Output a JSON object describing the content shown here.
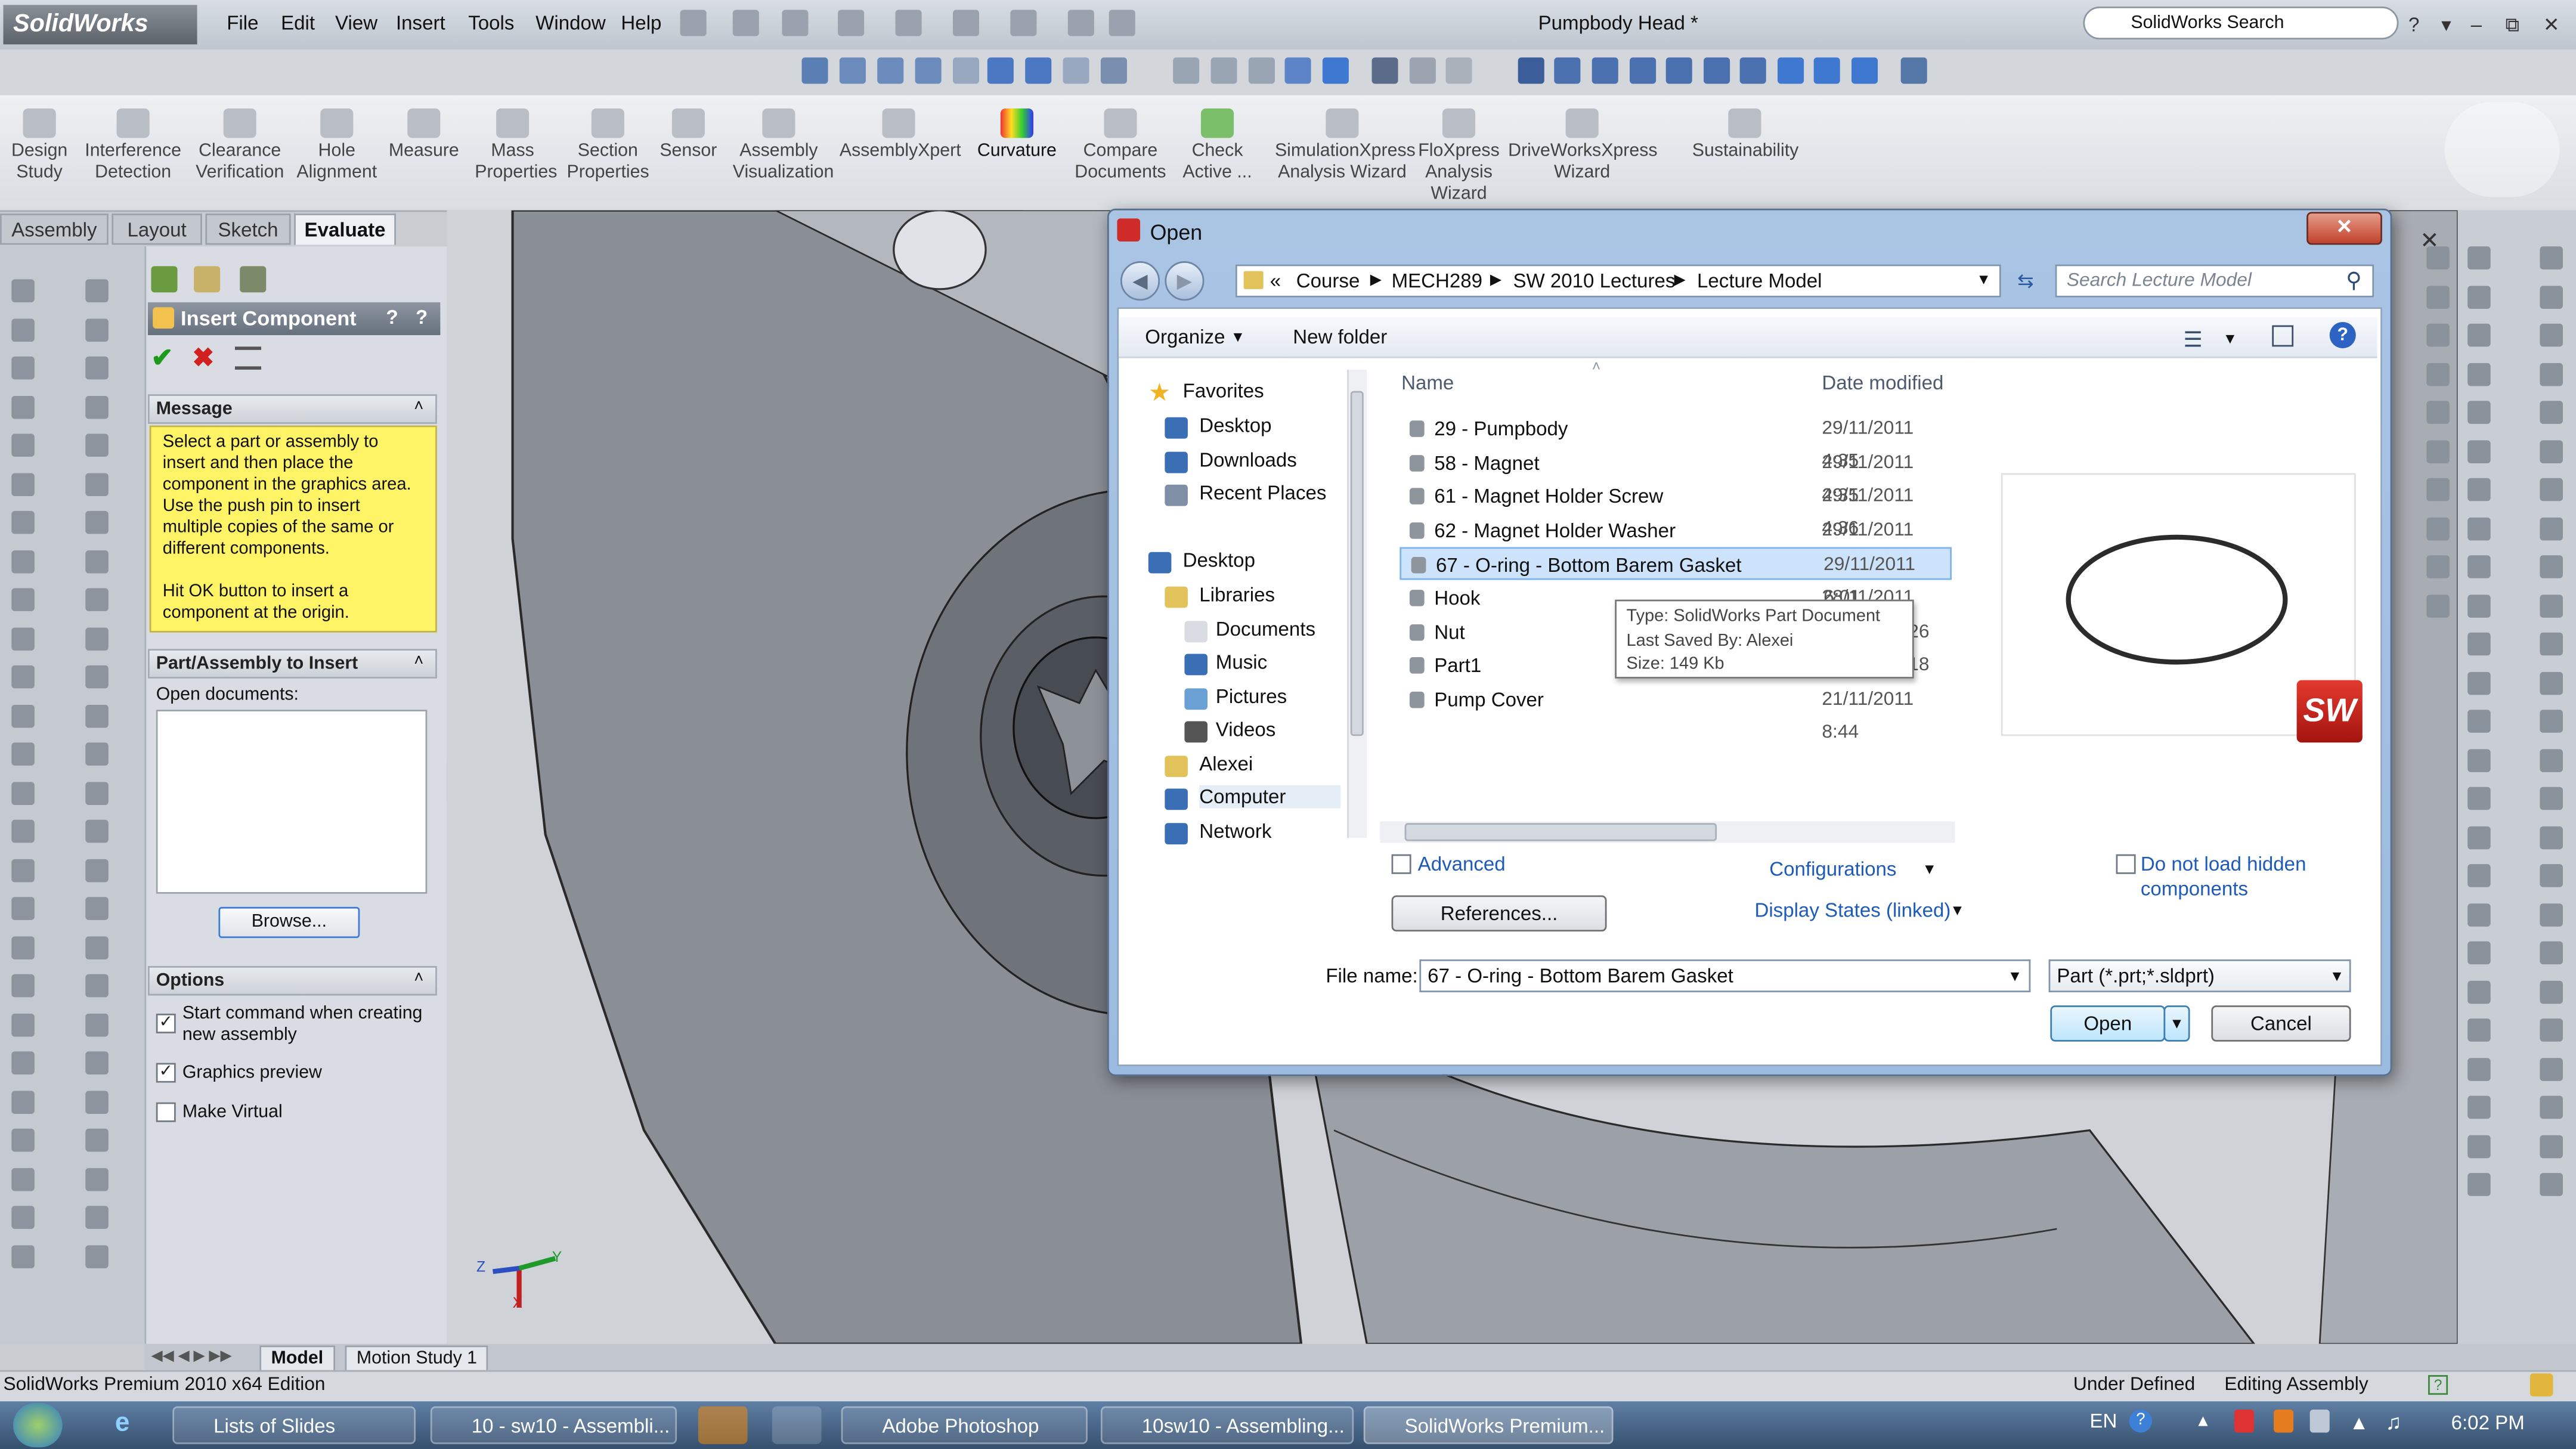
{
  "app": {
    "logo": "SolidWorks",
    "menu": [
      "File",
      "Edit",
      "View",
      "Insert",
      "Tools",
      "Window",
      "Help"
    ],
    "document_title": "Pumpbody Head *",
    "search_placeholder": "SolidWorks Search"
  },
  "command_manager": {
    "buttons": [
      {
        "label": "Design\nStudy",
        "icon": "design-study-icon"
      },
      {
        "label": "Interference\nDetection",
        "icon": "interference-detection-icon"
      },
      {
        "label": "Clearance\nVerification",
        "icon": "clearance-verification-icon"
      },
      {
        "label": "Hole\nAlignment",
        "icon": "hole-alignment-icon"
      },
      {
        "label": "Measure",
        "icon": "measure-icon"
      },
      {
        "label": "Mass\nProperties",
        "icon": "mass-properties-icon"
      },
      {
        "label": "Section\nProperties",
        "icon": "section-properties-icon"
      },
      {
        "label": "Sensor",
        "icon": "sensor-icon"
      },
      {
        "label": "Assembly\nVisualization",
        "icon": "assembly-visualization-icon"
      },
      {
        "label": "AssemblyXpert",
        "icon": "assemblyxpert-icon"
      },
      {
        "label": "Curvature",
        "icon": "curvature-icon"
      },
      {
        "label": "Compare\nDocuments",
        "icon": "compare-documents-icon"
      },
      {
        "label": "Check\nActive ...",
        "icon": "check-active-icon"
      },
      {
        "label": "SimulationXpress\nAnalysis Wizard",
        "icon": "simulationxpress-icon"
      },
      {
        "label": "FloXpress\nAnalysis\nWizard",
        "icon": "floxpress-icon"
      },
      {
        "label": "DriveWorksXpress\nWizard",
        "icon": "driveworksxpress-icon"
      },
      {
        "label": "Sustainability",
        "icon": "sustainability-icon"
      }
    ],
    "tabs": [
      "Assembly",
      "Layout",
      "Sketch",
      "Evaluate"
    ],
    "active_tab": "Evaluate"
  },
  "property_manager": {
    "title": "Insert Component",
    "message_header": "Message",
    "message": "Select a part or assembly to insert and then place the component in the graphics area. Use the push pin to insert multiple copies of the same or different components.\n\nHit OK button to insert a component at the origin.",
    "part_header": "Part/Assembly to Insert",
    "open_documents_label": "Open documents:",
    "browse_label": "Browse...",
    "options_header": "Options",
    "options": [
      {
        "label": "Start command when creating new assembly",
        "checked": true
      },
      {
        "label": "Graphics preview",
        "checked": true
      },
      {
        "label": "Make Virtual",
        "checked": false
      }
    ]
  },
  "dialog": {
    "title": "Open",
    "breadcrumb": [
      "«",
      "Course",
      "MECH289",
      "SW 2010 Lectures",
      "Lecture Model"
    ],
    "search_placeholder": "Search Lecture Model",
    "organize_label": "Organize",
    "new_folder_label": "New folder",
    "nav": [
      {
        "label": "Favorites",
        "indent": 0,
        "icon": "star-icon"
      },
      {
        "label": "Desktop",
        "indent": 1,
        "icon": "desktop-icon"
      },
      {
        "label": "Downloads",
        "indent": 1,
        "icon": "downloads-icon"
      },
      {
        "label": "Recent Places",
        "indent": 1,
        "icon": "recent-places-icon"
      },
      {
        "label": "",
        "indent": 0,
        "icon": ""
      },
      {
        "label": "Desktop",
        "indent": 0,
        "icon": "desktop-icon"
      },
      {
        "label": "Libraries",
        "indent": 1,
        "icon": "libraries-icon"
      },
      {
        "label": "Documents",
        "indent": 2,
        "icon": "documents-icon"
      },
      {
        "label": "Music",
        "indent": 2,
        "icon": "music-icon"
      },
      {
        "label": "Pictures",
        "indent": 2,
        "icon": "pictures-icon"
      },
      {
        "label": "Videos",
        "indent": 2,
        "icon": "videos-icon"
      },
      {
        "label": "Alexei",
        "indent": 1,
        "icon": "user-folder-icon"
      },
      {
        "label": "Computer",
        "indent": 1,
        "icon": "computer-icon"
      },
      {
        "label": "Network",
        "indent": 1,
        "icon": "network-icon"
      }
    ],
    "columns": {
      "name": "Name",
      "date": "Date modified"
    },
    "files": [
      {
        "name": "29 - Pumpbody",
        "date": "29/11/2011 4:35"
      },
      {
        "name": "58 - Magnet",
        "date": "29/11/2011 4:35"
      },
      {
        "name": "61 - Magnet Holder Screw",
        "date": "29/11/2011 4:36"
      },
      {
        "name": "62 - Magnet Holder Washer",
        "date": "29/11/2011 4:36"
      },
      {
        "name": "67 - O-ring - Bottom Barem Gasket",
        "date": "29/11/2011 6:01",
        "selected": true
      },
      {
        "name": "Hook",
        "date": "28/11/2011 10:0"
      },
      {
        "name": "Nut",
        "date": "7:26"
      },
      {
        "name": "Part1",
        "date": "9:18"
      },
      {
        "name": "Pump Cover",
        "date": "21/11/2011 8:44"
      }
    ],
    "tooltip": [
      "Type: SolidWorks Part Document",
      "Last Saved By: Alexei",
      "Size: 149 Kb"
    ],
    "advanced_label": "Advanced",
    "references_label": "References...",
    "configurations_label": "Configurations",
    "display_states_label": "Display States (linked)",
    "hidden_components_label": "Do not load hidden components",
    "file_name_label": "File name:",
    "file_name_value": "67 - O-ring - Bottom Barem Gasket",
    "file_type": "Part (*.prt;*.sldprt)",
    "open_label": "Open",
    "cancel_label": "Cancel",
    "preview_badge": "SW"
  },
  "model_tabs": [
    "Model",
    "Motion Study 1"
  ],
  "status": {
    "left": "SolidWorks Premium 2010 x64 Edition",
    "under_defined": "Under Defined",
    "editing": "Editing Assembly"
  },
  "taskbar": {
    "items": [
      "Lists of Slides",
      "10 - sw10 - Assembli...",
      "Adobe Photoshop",
      "10sw10 - Assembling...",
      "SolidWorks Premium..."
    ],
    "lang": "EN",
    "time": "6:02 PM"
  },
  "triad_labels": {
    "x": "X",
    "y": "Y",
    "z": "Z"
  },
  "colors": {
    "accent": "#3d7bd6",
    "message_bg": "#fff466",
    "selection": "#cde3fb",
    "taskbar": "#36506f"
  }
}
